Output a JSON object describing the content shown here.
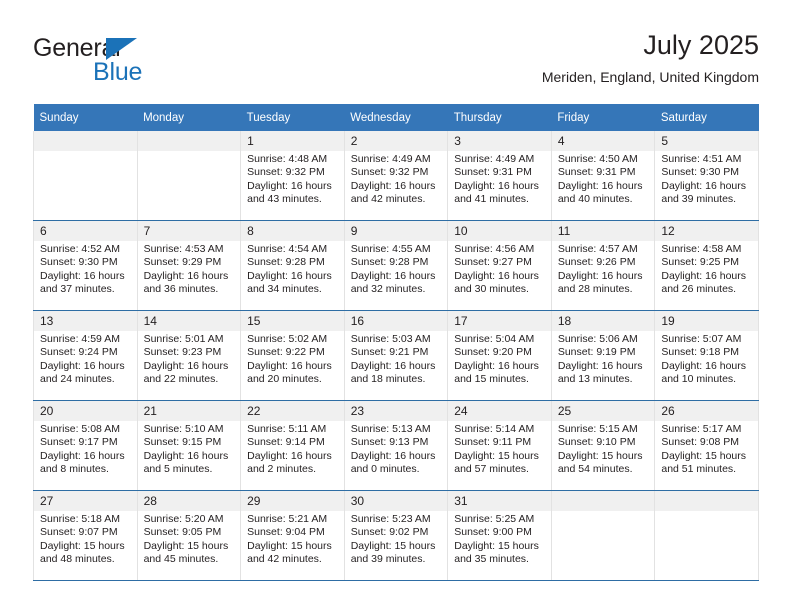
{
  "brand": {
    "name_top": "General",
    "name_bottom": "Blue",
    "accent_color": "#1b72b8"
  },
  "header": {
    "month_title": "July 2025",
    "location": "Meriden, England, United Kingdom"
  },
  "theme": {
    "header_bg": "#3576b8",
    "row_divider": "#2e6da4",
    "daynum_bg": "#f0f0f0"
  },
  "calendar": {
    "weekday_headers": [
      "Sunday",
      "Monday",
      "Tuesday",
      "Wednesday",
      "Thursday",
      "Friday",
      "Saturday"
    ],
    "labels": {
      "sunrise": "Sunrise:",
      "sunset": "Sunset:",
      "daylight": "Daylight:"
    },
    "weeks": [
      [
        {
          "day": "",
          "empty": true
        },
        {
          "day": "",
          "empty": true
        },
        {
          "day": "1",
          "sunrise": "Sunrise: 4:48 AM",
          "sunset": "Sunset: 9:32 PM",
          "daylight_1": "Daylight: 16 hours",
          "daylight_2": "and 43 minutes."
        },
        {
          "day": "2",
          "sunrise": "Sunrise: 4:49 AM",
          "sunset": "Sunset: 9:32 PM",
          "daylight_1": "Daylight: 16 hours",
          "daylight_2": "and 42 minutes."
        },
        {
          "day": "3",
          "sunrise": "Sunrise: 4:49 AM",
          "sunset": "Sunset: 9:31 PM",
          "daylight_1": "Daylight: 16 hours",
          "daylight_2": "and 41 minutes."
        },
        {
          "day": "4",
          "sunrise": "Sunrise: 4:50 AM",
          "sunset": "Sunset: 9:31 PM",
          "daylight_1": "Daylight: 16 hours",
          "daylight_2": "and 40 minutes."
        },
        {
          "day": "5",
          "sunrise": "Sunrise: 4:51 AM",
          "sunset": "Sunset: 9:30 PM",
          "daylight_1": "Daylight: 16 hours",
          "daylight_2": "and 39 minutes."
        }
      ],
      [
        {
          "day": "6",
          "sunrise": "Sunrise: 4:52 AM",
          "sunset": "Sunset: 9:30 PM",
          "daylight_1": "Daylight: 16 hours",
          "daylight_2": "and 37 minutes."
        },
        {
          "day": "7",
          "sunrise": "Sunrise: 4:53 AM",
          "sunset": "Sunset: 9:29 PM",
          "daylight_1": "Daylight: 16 hours",
          "daylight_2": "and 36 minutes."
        },
        {
          "day": "8",
          "sunrise": "Sunrise: 4:54 AM",
          "sunset": "Sunset: 9:28 PM",
          "daylight_1": "Daylight: 16 hours",
          "daylight_2": "and 34 minutes."
        },
        {
          "day": "9",
          "sunrise": "Sunrise: 4:55 AM",
          "sunset": "Sunset: 9:28 PM",
          "daylight_1": "Daylight: 16 hours",
          "daylight_2": "and 32 minutes."
        },
        {
          "day": "10",
          "sunrise": "Sunrise: 4:56 AM",
          "sunset": "Sunset: 9:27 PM",
          "daylight_1": "Daylight: 16 hours",
          "daylight_2": "and 30 minutes."
        },
        {
          "day": "11",
          "sunrise": "Sunrise: 4:57 AM",
          "sunset": "Sunset: 9:26 PM",
          "daylight_1": "Daylight: 16 hours",
          "daylight_2": "and 28 minutes."
        },
        {
          "day": "12",
          "sunrise": "Sunrise: 4:58 AM",
          "sunset": "Sunset: 9:25 PM",
          "daylight_1": "Daylight: 16 hours",
          "daylight_2": "and 26 minutes."
        }
      ],
      [
        {
          "day": "13",
          "sunrise": "Sunrise: 4:59 AM",
          "sunset": "Sunset: 9:24 PM",
          "daylight_1": "Daylight: 16 hours",
          "daylight_2": "and 24 minutes."
        },
        {
          "day": "14",
          "sunrise": "Sunrise: 5:01 AM",
          "sunset": "Sunset: 9:23 PM",
          "daylight_1": "Daylight: 16 hours",
          "daylight_2": "and 22 minutes."
        },
        {
          "day": "15",
          "sunrise": "Sunrise: 5:02 AM",
          "sunset": "Sunset: 9:22 PM",
          "daylight_1": "Daylight: 16 hours",
          "daylight_2": "and 20 minutes."
        },
        {
          "day": "16",
          "sunrise": "Sunrise: 5:03 AM",
          "sunset": "Sunset: 9:21 PM",
          "daylight_1": "Daylight: 16 hours",
          "daylight_2": "and 18 minutes."
        },
        {
          "day": "17",
          "sunrise": "Sunrise: 5:04 AM",
          "sunset": "Sunset: 9:20 PM",
          "daylight_1": "Daylight: 16 hours",
          "daylight_2": "and 15 minutes."
        },
        {
          "day": "18",
          "sunrise": "Sunrise: 5:06 AM",
          "sunset": "Sunset: 9:19 PM",
          "daylight_1": "Daylight: 16 hours",
          "daylight_2": "and 13 minutes."
        },
        {
          "day": "19",
          "sunrise": "Sunrise: 5:07 AM",
          "sunset": "Sunset: 9:18 PM",
          "daylight_1": "Daylight: 16 hours",
          "daylight_2": "and 10 minutes."
        }
      ],
      [
        {
          "day": "20",
          "sunrise": "Sunrise: 5:08 AM",
          "sunset": "Sunset: 9:17 PM",
          "daylight_1": "Daylight: 16 hours",
          "daylight_2": "and 8 minutes."
        },
        {
          "day": "21",
          "sunrise": "Sunrise: 5:10 AM",
          "sunset": "Sunset: 9:15 PM",
          "daylight_1": "Daylight: 16 hours",
          "daylight_2": "and 5 minutes."
        },
        {
          "day": "22",
          "sunrise": "Sunrise: 5:11 AM",
          "sunset": "Sunset: 9:14 PM",
          "daylight_1": "Daylight: 16 hours",
          "daylight_2": "and 2 minutes."
        },
        {
          "day": "23",
          "sunrise": "Sunrise: 5:13 AM",
          "sunset": "Sunset: 9:13 PM",
          "daylight_1": "Daylight: 16 hours",
          "daylight_2": "and 0 minutes."
        },
        {
          "day": "24",
          "sunrise": "Sunrise: 5:14 AM",
          "sunset": "Sunset: 9:11 PM",
          "daylight_1": "Daylight: 15 hours",
          "daylight_2": "and 57 minutes."
        },
        {
          "day": "25",
          "sunrise": "Sunrise: 5:15 AM",
          "sunset": "Sunset: 9:10 PM",
          "daylight_1": "Daylight: 15 hours",
          "daylight_2": "and 54 minutes."
        },
        {
          "day": "26",
          "sunrise": "Sunrise: 5:17 AM",
          "sunset": "Sunset: 9:08 PM",
          "daylight_1": "Daylight: 15 hours",
          "daylight_2": "and 51 minutes."
        }
      ],
      [
        {
          "day": "27",
          "sunrise": "Sunrise: 5:18 AM",
          "sunset": "Sunset: 9:07 PM",
          "daylight_1": "Daylight: 15 hours",
          "daylight_2": "and 48 minutes."
        },
        {
          "day": "28",
          "sunrise": "Sunrise: 5:20 AM",
          "sunset": "Sunset: 9:05 PM",
          "daylight_1": "Daylight: 15 hours",
          "daylight_2": "and 45 minutes."
        },
        {
          "day": "29",
          "sunrise": "Sunrise: 5:21 AM",
          "sunset": "Sunset: 9:04 PM",
          "daylight_1": "Daylight: 15 hours",
          "daylight_2": "and 42 minutes."
        },
        {
          "day": "30",
          "sunrise": "Sunrise: 5:23 AM",
          "sunset": "Sunset: 9:02 PM",
          "daylight_1": "Daylight: 15 hours",
          "daylight_2": "and 39 minutes."
        },
        {
          "day": "31",
          "sunrise": "Sunrise: 5:25 AM",
          "sunset": "Sunset: 9:00 PM",
          "daylight_1": "Daylight: 15 hours",
          "daylight_2": "and 35 minutes."
        },
        {
          "day": "",
          "empty": true
        },
        {
          "day": "",
          "empty": true
        }
      ]
    ]
  }
}
